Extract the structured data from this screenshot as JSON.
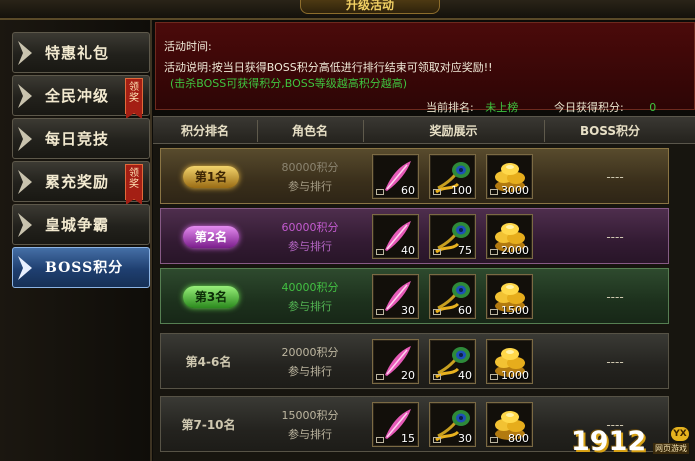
{
  "header": {
    "title": "升级活动"
  },
  "sidebar": {
    "items": [
      {
        "label": "特惠礼包",
        "badge": ""
      },
      {
        "label": "全民冲级",
        "badge": "领奖"
      },
      {
        "label": "每日竞技",
        "badge": ""
      },
      {
        "label": "累充奖励",
        "badge": "领奖"
      },
      {
        "label": "皇城争霸",
        "badge": ""
      },
      {
        "label": "BOSS积分",
        "badge": "",
        "active": true
      }
    ]
  },
  "info": {
    "time_label": "活动时间:",
    "desc_label": "活动说明:",
    "desc_text": "按当日获得BOSS积分高低进行排行结束可领取对应奖励!!",
    "hint": "(击杀BOSS可获得积分,BOSS等级越高积分越高)",
    "current_rank_label": "当前排名:",
    "current_rank_value": "未上榜",
    "today_points_label": "今日获得积分:",
    "today_points_value": "0"
  },
  "table": {
    "headers": [
      "积分排名",
      "角色名",
      "奖励展示",
      "BOSS积分"
    ],
    "rows": [
      {
        "rank": "第1名",
        "points": "80000积分",
        "join": "参与排行",
        "rewards": [
          "60",
          "100",
          "3000"
        ],
        "boss": "----"
      },
      {
        "rank": "第2名",
        "points": "60000积分",
        "join": "参与排行",
        "rewards": [
          "40",
          "75",
          "2000"
        ],
        "boss": "----"
      },
      {
        "rank": "第3名",
        "points": "40000积分",
        "join": "参与排行",
        "rewards": [
          "30",
          "60",
          "1500"
        ],
        "boss": "----"
      },
      {
        "rank": "第4-6名",
        "points": "20000积分",
        "join": "参与排行",
        "rewards": [
          "20",
          "40",
          "1000"
        ],
        "boss": "----"
      },
      {
        "rank": "第7-10名",
        "points": "15000积分",
        "join": "参与排行",
        "rewards": [
          "15",
          "30",
          "800"
        ],
        "boss": "----"
      }
    ]
  },
  "reward_icons": [
    "pink-feather-icon",
    "peacock-feather-icon",
    "gold-ingot-icon"
  ],
  "colors": {
    "gold": "#f3d46c",
    "purple": "#c35ad0",
    "green": "#42c042",
    "active_tab": "#2a5290",
    "panel_red": "#4b0a0a"
  },
  "watermark": {
    "number": "1912",
    "tag": "YX",
    "sub": "网页游戏"
  }
}
